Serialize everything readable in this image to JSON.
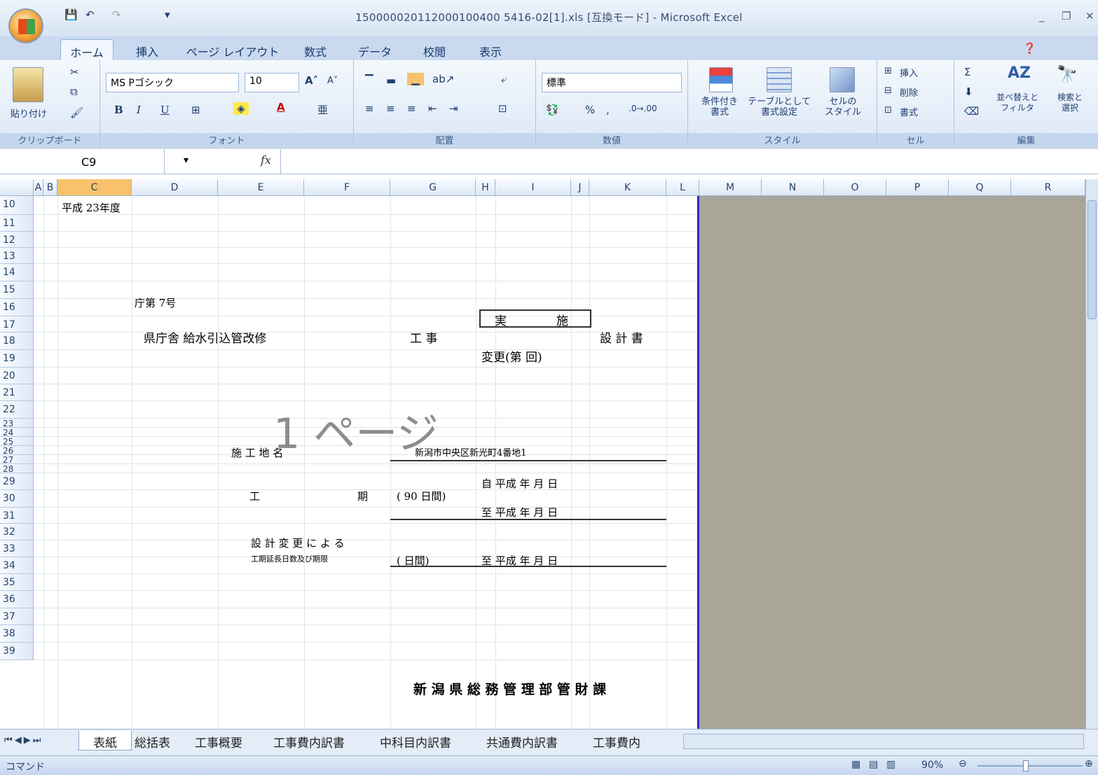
{
  "window": {
    "title": "150000020112000100400 5416-02[1].xls  [互換モード] - Microsoft Excel",
    "controls": [
      "_",
      "❐",
      "✕"
    ]
  },
  "ribbon_tabs": [
    "ホーム",
    "挿入",
    "ページ レイアウト",
    "数式",
    "データ",
    "校閲",
    "表示"
  ],
  "ribbon": {
    "clipboard": {
      "label": "クリップボード",
      "paste": "貼り付け"
    },
    "font": {
      "label": "フォント",
      "name": "MS Pゴシック",
      "size": "10",
      "bold": "B",
      "italic": "I",
      "underline": "U"
    },
    "alignment": {
      "label": "配置"
    },
    "number": {
      "label": "数値",
      "format": "標準",
      "percent": "%"
    },
    "styles": {
      "label": "スタイル",
      "conditional": "条件付き\n書式",
      "table": "テーブルとして\n書式設定",
      "cell_style": "セルの\nスタイル"
    },
    "cells": {
      "label": "セル",
      "insert": "挿入",
      "delete": "削除",
      "format": "書式"
    },
    "editing": {
      "label": "編集",
      "sort": "並べ替えと\nフィルタ",
      "find": "検索と\n選択"
    }
  },
  "formula_bar": {
    "name_box": "C9",
    "fx": "fx",
    "content": ""
  },
  "columns": [
    "A",
    "B",
    "C",
    "D",
    "E",
    "F",
    "G",
    "H",
    "I",
    "J",
    "K",
    "L",
    "M",
    "N",
    "O",
    "P",
    "Q",
    "R"
  ],
  "rows": [
    "10",
    "11",
    "12",
    "13",
    "14",
    "15",
    "16",
    "17",
    "18",
    "19",
    "20",
    "21",
    "22",
    "23",
    "24",
    "25",
    "26",
    "27",
    "28",
    "29",
    "30",
    "31",
    "32",
    "33",
    "34",
    "35",
    "36",
    "37",
    "38",
    "39"
  ],
  "cells": {
    "fiscal_year": "平成 23年度",
    "dept_no": "庁第  7号",
    "project_name": "県庁舎 給水引込管改修",
    "construction": "工  事",
    "jisshi": "実",
    "jisshi2": "施",
    "sekkeisho": "設 計 書",
    "henkou": "変更(第    回)",
    "page_watermark": "1 ページ",
    "site_label": "施    工    地    名",
    "site_value": "新潟市中央区新光町4番地1",
    "period_label1": "工",
    "period_label2": "期",
    "days": "(  90 日間)",
    "from": "自 平成     年        月       日",
    "to": "至 平成     年        月       日",
    "change_label": "設 計 変 更 に よ る",
    "change_sub": "工期延長日数及び期限",
    "change_days": "(      日間)",
    "change_to": "至 平成     年        月       日",
    "dept": "新 潟 県 総 務 管 理 部 管 財 課"
  },
  "sheet_tabs": [
    "表紙",
    "総括表",
    "工事概要",
    "工事費内訳書",
    "中科目内訳書",
    "共通費内訳書",
    "工事費内"
  ],
  "status": {
    "mode": "コマンド",
    "zoom": "90%"
  }
}
